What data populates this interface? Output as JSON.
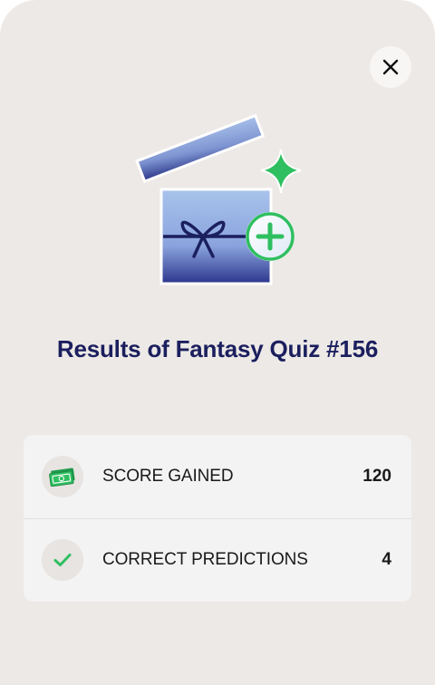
{
  "dialog": {
    "title": "Results of Fantasy Quiz #156",
    "close_icon": "close-icon",
    "illustration_icon": "gift-box-plus-icon"
  },
  "stats": [
    {
      "icon": "cash-icon",
      "label": "SCORE GAINED",
      "value": "120"
    },
    {
      "icon": "checkmark-icon",
      "label": "CORRECT PREDICTIONS",
      "value": "4"
    }
  ],
  "colors": {
    "background": "#ede9e6",
    "title": "#1b1f5e",
    "accent_green": "#2fbf60",
    "card": "#f3f3f4"
  }
}
